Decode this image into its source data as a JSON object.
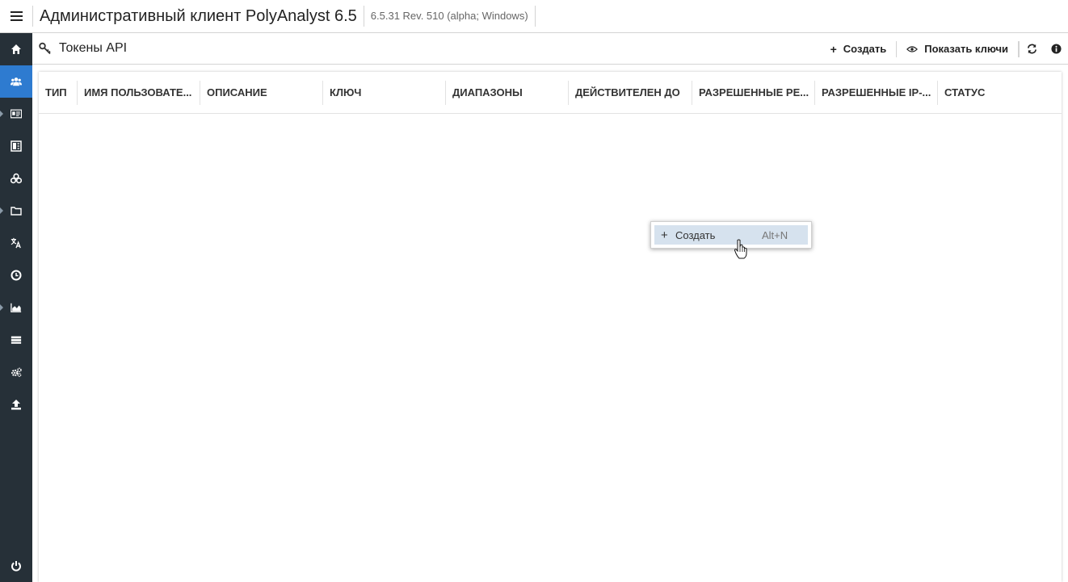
{
  "header": {
    "title": "Административный клиент PolyAnalyst 6.5",
    "version": "6.5.31 Rev. 510 (alpha; Windows)"
  },
  "sidebar": {
    "items": [
      {
        "name": "home-icon",
        "active": false,
        "has_caret": false
      },
      {
        "name": "users-icon",
        "active": true,
        "has_caret": true
      },
      {
        "name": "id-card-icon",
        "active": false,
        "has_caret": true
      },
      {
        "name": "book-icon",
        "active": false,
        "has_caret": false
      },
      {
        "name": "cubes-icon",
        "active": false,
        "has_caret": false
      },
      {
        "name": "folder-icon",
        "active": false,
        "has_caret": true
      },
      {
        "name": "translate-icon",
        "active": false,
        "has_caret": false
      },
      {
        "name": "clock-icon",
        "active": false,
        "has_caret": false
      },
      {
        "name": "area-chart-icon",
        "active": false,
        "has_caret": true
      },
      {
        "name": "server-icon",
        "active": false,
        "has_caret": false
      },
      {
        "name": "cogs-icon",
        "active": false,
        "has_caret": false
      },
      {
        "name": "upload-icon",
        "active": false,
        "has_caret": false
      },
      {
        "name": "power-icon",
        "active": false,
        "has_caret": false
      }
    ],
    "colors": {
      "background": "#263038",
      "active": "#2e7bd0",
      "icon": "#ffffff"
    }
  },
  "toolbar": {
    "title": "Токены API",
    "create_label": "Создать",
    "show_keys_label": "Показать ключи"
  },
  "grid": {
    "columns": [
      "ТИП",
      "ИМЯ ПОЛЬЗОВАТЕ...",
      "ОПИСАНИЕ",
      "КЛЮЧ",
      "ДИАПАЗОНЫ",
      "ДЕЙСТВИТЕЛЕН ДО",
      "РАЗРЕШЕННЫЕ РЕ...",
      "РАЗРЕШЕННЫЕ IP-...",
      "СТАТУС"
    ],
    "rows": []
  },
  "context_menu": {
    "items": [
      {
        "label": "Создать",
        "shortcut": "Alt+N",
        "highlighted": true
      }
    ]
  }
}
